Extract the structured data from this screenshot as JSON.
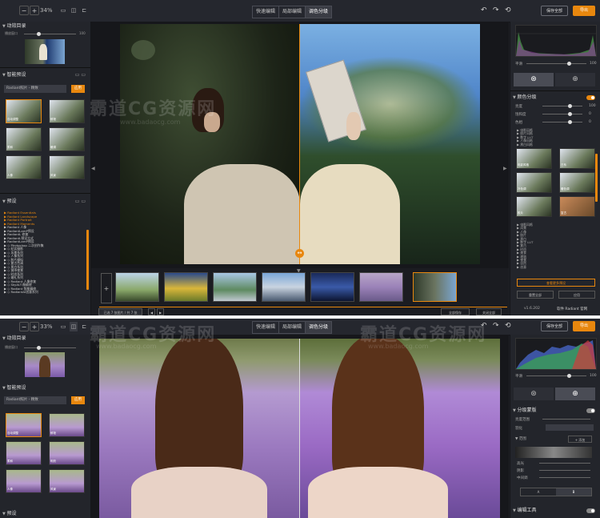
{
  "colors": {
    "accent": "#e8870e",
    "bg": "#1e2026",
    "panel": "#23252b"
  },
  "top": {
    "zoom1": "34%",
    "zoom2": "33%",
    "minus": "−",
    "plus": "+",
    "tabs": [
      "快速编辑",
      "局部编辑",
      "调色分级"
    ],
    "save": "保存全部",
    "export": "导出",
    "undo": "↶",
    "redo": "↷",
    "reset": "⟲"
  },
  "left": {
    "nav_title": "动效目录",
    "nav_label": "播放窗口",
    "nav_val": "100",
    "smart_title": "智能预设",
    "smart_select": "Radiant照片 - 精致",
    "smart_btn": "应用",
    "thumbs1": [
      "自动调整",
      "鲜艳",
      "柔和",
      "暖调",
      "人像",
      "风景"
    ],
    "thumbs2": [
      "自动调整",
      "鲜艳",
      "柔和",
      "明亮",
      "人像",
      "风景"
    ],
    "preset_title": "预设",
    "presets": [
      "▶ Radiant Essentials",
      "▶ Radiant Landscape",
      "▶ Radiant Portrait",
      "▶ Radiant Moments",
      "▶ Radiant 人像",
      "▶ RadiantLamP预设",
      "▶ RadiantL 修复",
      "▶ RadiantL预设方式",
      "▶ RadiantLamP预设",
      "▶ ◇ Photoshop 二次创作集",
      "▶ ◇ 纪实摄影",
      "▶ ◇ 风景系列",
      "▶ ◇ 人像系列",
      "▶ ◇ 胶片模拟",
      "▶ ◇ 复古色调",
      "▶ ◇ 黑白系列",
      "▶ ◇ 城市夜景",
      "▶ ◇ 时尚系列",
      "▶ ◇ 婚礼系列",
      "▶ ◇ Radiant 人像修复",
      "▶ ◇ SkyAI人像精修",
      "▶ ◇ Radiant 智能精修",
      "▶ ◇ RadiantAI创意系列"
    ],
    "preset_title2": "预设"
  },
  "right": {
    "hist_label": "平滑",
    "hist_val": "100",
    "grading_title": "颜色分级",
    "grading_rows": [
      {
        "label": "亮度",
        "val": "100"
      },
      {
        "label": "饱和度",
        "val": "0"
      },
      {
        "label": "色相",
        "val": "0"
      }
    ],
    "grading_list": [
      "▶ 电影风格",
      "▶ 胶片风格",
      "▶ 数字 LUT",
      "▶ 人像风格",
      "▶ 黑白风格"
    ],
    "grading_thumbs": [
      "电影风格",
      "日系",
      "冷色调",
      "暖色调",
      "胶片",
      "复古"
    ],
    "grading_list2": [
      "▶ 电影风格",
      "▶ 风景",
      "▶ 人像",
      "▶ 胶片",
      "▶ 黑白",
      "▶ 数字 LUT",
      "▶ 复古",
      "▶ 时尚",
      "▶ 美食",
      "▶ 建筑",
      "▶ 夜景",
      "▶ 自然",
      "▶ 创意",
      "▶ 季节",
      "▶ 高级感",
      "▶ 婚礼",
      "▶ 清新",
      "▶ 日系",
      "▶ 港风",
      "▶ 胶片模拟"
    ],
    "grading_more": "查看更多预设",
    "btn_reset": "重置全部",
    "btn_apply": "应用",
    "version": "v1.6.202",
    "brand": "软件 Radiant 官网",
    "mask_title": "分级蒙版",
    "mask_rows": [
      "亮度范围",
      "羽化"
    ],
    "mask_more": "▼ 范围",
    "mask_add": "+ 添加",
    "mask_sub": [
      "高光",
      "阴影",
      "中间调"
    ],
    "mask_tabs": [
      "A",
      "B"
    ],
    "tool_title": "编辑工具"
  },
  "film": {
    "prev": "◀",
    "next": "▶",
    "add": "+",
    "footer_btns": [
      "全部保存",
      "关闭全部"
    ],
    "filter": "已选 7 张图片 / 共 7 张",
    "count": "7",
    "select_all": "全选"
  },
  "watermark": {
    "big1": "霸道CG资源网",
    "sub1": "www.badaocg.com",
    "big2": "霸道CG资源网",
    "sub2": "www.badaocg.com"
  }
}
